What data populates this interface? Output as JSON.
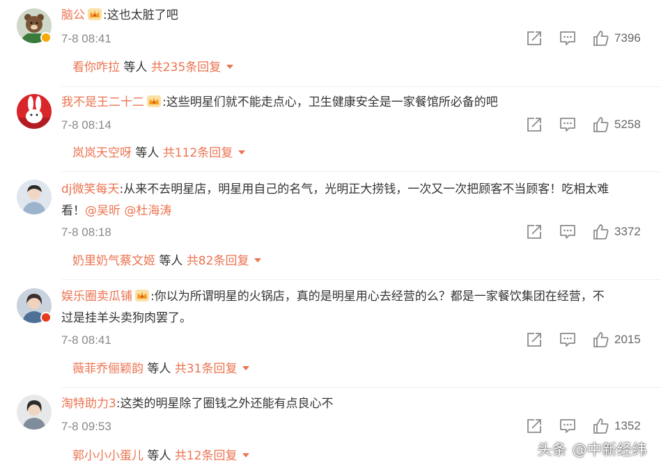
{
  "colors": {
    "username": "#eb7350",
    "text": "#333333",
    "time": "#888888",
    "icon": "#8a8a8a"
  },
  "comments": [
    {
      "username": "脑公",
      "separator": ":",
      "text": "这也太脏了吧",
      "text_cont": "",
      "mentions": "",
      "time": "7-8 08:41",
      "likes": "7396",
      "reply_users": "看你咋拉",
      "reply_mid": " 等人 ",
      "reply_count": "共235条回复",
      "avatar_icon": "bear-avatar",
      "badge": "gold"
    },
    {
      "username": "我不是王二十二",
      "separator": ":",
      "text": "这些明星们就不能走点心，卫生健康安全是一家餐馆所必备的吧",
      "text_cont": "",
      "mentions": "",
      "time": "7-8 08:14",
      "likes": "5258",
      "reply_users": "岚岚天空呀",
      "reply_mid": " 等人 ",
      "reply_count": "共112条回复",
      "avatar_icon": "rabbit-avatar",
      "badge": ""
    },
    {
      "username": "dj微笑每天",
      "separator": ":",
      "text": "从来不去明星店，明星用自己的名气，光明正大捞钱，一次又一次把顾客不当顾客！吃相太难",
      "text_cont": "看！",
      "mentions": "@吴昕 @杜海涛",
      "time": "7-8 08:18",
      "likes": "3372",
      "reply_users": "奶里奶气蔡文姬",
      "reply_mid": " 等人 ",
      "reply_count": "共82条回复",
      "avatar_icon": "person-avatar",
      "badge": ""
    },
    {
      "username": "娱乐圈卖瓜铺",
      "separator": ":",
      "text": "你以为所谓明星的火锅店，真的是明星用心去经营的么？都是一家餐饮集团在经营，不",
      "text_cont": "过是挂羊头卖狗肉罢了。",
      "mentions": "",
      "time": "7-8 08:41",
      "likes": "2015",
      "reply_users": "薇菲乔俪颖韵",
      "reply_mid": " 等人 ",
      "reply_count": "共31条回复",
      "avatar_icon": "person-avatar",
      "badge": "red"
    },
    {
      "username": "淘特助力3",
      "separator": ":",
      "text": "这类的明星除了圈钱之外还能有点良心不",
      "text_cont": "",
      "mentions": "",
      "time": "7-8 09:53",
      "likes": "1352",
      "reply_users": "郭小小小蛋儿",
      "reply_mid": " 等人 ",
      "reply_count": "共12条回复",
      "avatar_icon": "person-avatar",
      "badge": ""
    }
  ],
  "watermark": "头条 @中新经纬"
}
